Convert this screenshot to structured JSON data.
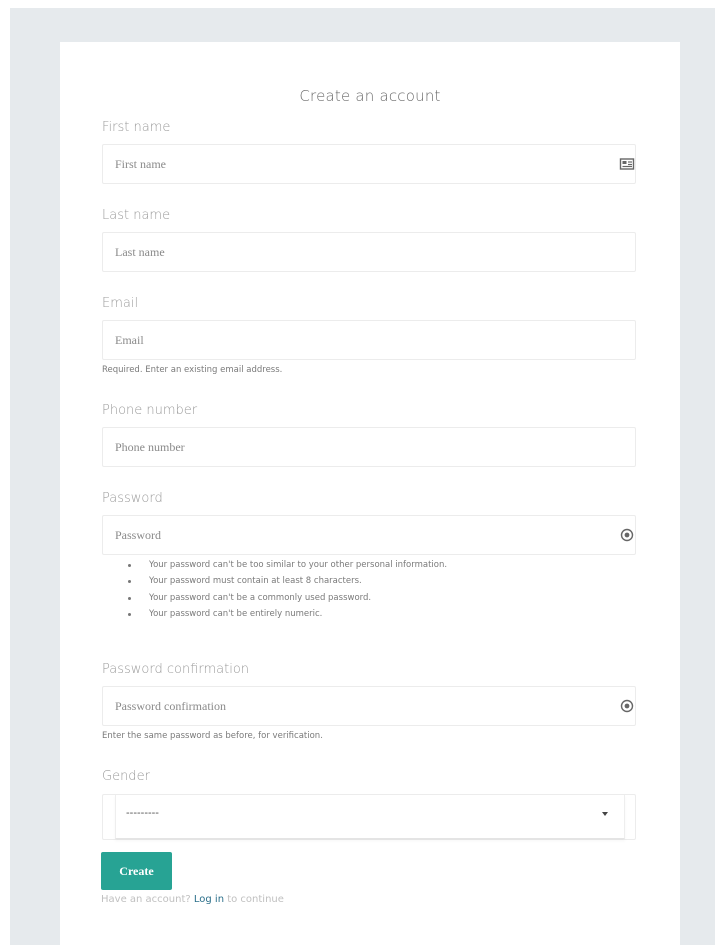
{
  "form": {
    "title": "Create an account",
    "fields": {
      "first_name": {
        "label": "First name",
        "placeholder": "First name",
        "icon": "id-card-icon"
      },
      "last_name": {
        "label": "Last name",
        "placeholder": "Last name"
      },
      "email": {
        "label": "Email",
        "placeholder": "Email",
        "help": "Required. Enter an existing email address."
      },
      "phone": {
        "label": "Phone number",
        "placeholder": "Phone number"
      },
      "password": {
        "label": "Password",
        "placeholder": "Password",
        "icon": "eye-icon",
        "rules": [
          "Your password can't be too similar to your other personal information.",
          "Your password must contain at least 8 characters.",
          "Your password can't be a commonly used password.",
          "Your password can't be entirely numeric."
        ]
      },
      "password_confirmation": {
        "label": "Password confirmation",
        "placeholder": "Password confirmation",
        "icon": "eye-icon",
        "help": "Enter the same password as before, for verification."
      },
      "gender": {
        "label": "Gender",
        "selected": "---------"
      }
    },
    "submit_label": "Create",
    "login_prompt": {
      "before": "Have an account?",
      "link": "Log in",
      "after": "to continue"
    }
  },
  "colors": {
    "page_background": "#e6eaed",
    "accent": "#27a394",
    "link": "#2b6f8a"
  }
}
